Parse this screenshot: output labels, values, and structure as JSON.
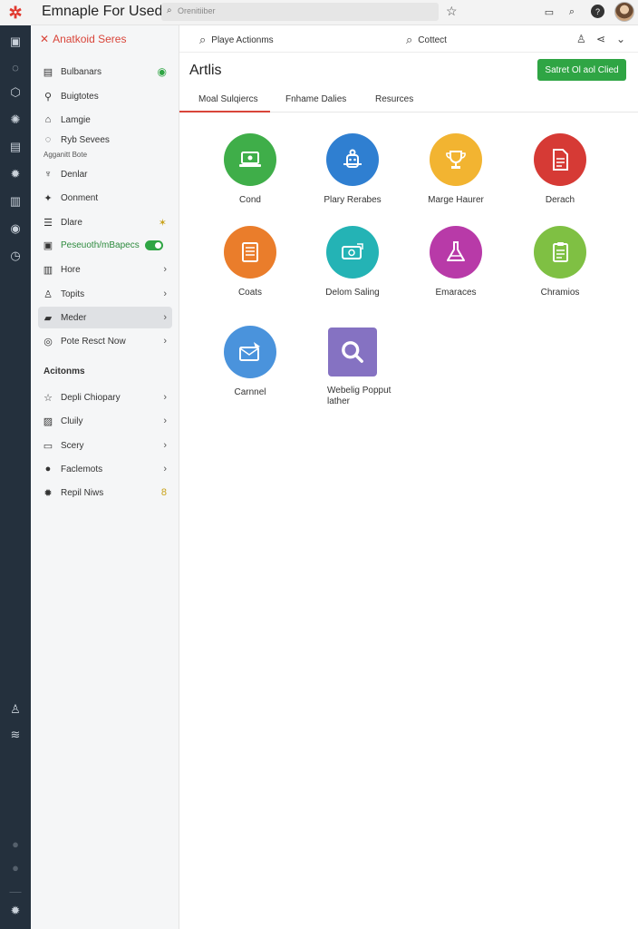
{
  "app": {
    "title": "Emnaple For Used)",
    "search_placeholder": "Orenitiiber",
    "accent_color": "#d9453a",
    "primary_color": "#2fa544"
  },
  "rail": {
    "logo_icon": "app-logo-icon",
    "icons": [
      "home-icon",
      "refresh-icon",
      "settings-icon",
      "gear-icon",
      "chat-icon",
      "cog-icon",
      "building-icon",
      "globe-icon",
      "clock-icon",
      "person-icon",
      "layers-icon",
      "settings-icon"
    ]
  },
  "sidebar": {
    "header": "Anatkoid Seres",
    "sub_caption": "Agganitt Bote",
    "items": [
      {
        "label": "Bulbanars",
        "icon": "grid-icon",
        "trail": "●"
      },
      {
        "label": "Buigtotes",
        "icon": "person-icon",
        "trail": ""
      },
      {
        "label": "Lamgie",
        "icon": "home-icon",
        "trail": ""
      },
      {
        "label": "Ryb Sevees",
        "icon": "chat-icon",
        "trail": ""
      },
      {
        "label": "Denlar",
        "icon": "lamp-icon",
        "trail": ""
      },
      {
        "label": "Oonment",
        "icon": "bird-icon",
        "trail": ""
      },
      {
        "label": "Dlare",
        "icon": "list-icon",
        "trail": "✶"
      },
      {
        "label": "Peseuoth/mBapecs",
        "icon": "table-icon",
        "trail": ""
      },
      {
        "label": "Hore",
        "icon": "box-icon",
        "trail": "›"
      },
      {
        "label": "Topits",
        "icon": "person-icon",
        "trail": "›"
      },
      {
        "label": "Meder",
        "icon": "folder-icon",
        "trail": "›"
      },
      {
        "label": "Pote Resct Now",
        "icon": "bulb-icon",
        "trail": "›"
      }
    ],
    "actions_title": "Acitonms",
    "actions": [
      {
        "label": "Depli Chiopary",
        "icon": "star-icon",
        "trail": "›"
      },
      {
        "label": "Cluily",
        "icon": "image-icon",
        "trail": "›"
      },
      {
        "label": "Scery",
        "icon": "frame-icon",
        "trail": "›"
      },
      {
        "label": "Faclemots",
        "icon": "circle-icon",
        "trail": "›"
      },
      {
        "label": "Repil Niws",
        "icon": "gear-icon",
        "trail": "8"
      }
    ]
  },
  "content": {
    "toolbar": {
      "search_a": "Playe Actionms",
      "search_b": "Cottect"
    },
    "title": "Artlis",
    "primary_button": "Satret Ol aol Clied",
    "tabs": [
      "Moal Sulqiercs",
      "Fnhame Dalies",
      "Resurces"
    ],
    "tiles": [
      {
        "label": "Cond",
        "color": "#3fae49",
        "icon": "laptop-icon"
      },
      {
        "label": "Plary Rerabes",
        "color": "#2f7fd1",
        "icon": "robot-icon"
      },
      {
        "label": "Marge Haurer",
        "color": "#f2b431",
        "icon": "trophy-icon"
      },
      {
        "label": "Derach",
        "color": "#d63a35",
        "icon": "document-icon"
      },
      {
        "label": "Coats",
        "color": "#ea7d2b",
        "icon": "notebook-icon"
      },
      {
        "label": "Delom Saling",
        "color": "#24b3b5",
        "icon": "money-icon"
      },
      {
        "label": "Emaraces",
        "color": "#b83aa8",
        "icon": "flask-icon"
      },
      {
        "label": "Chramios",
        "color": "#7fc043",
        "icon": "clipboard-icon"
      },
      {
        "label": "Carnnel",
        "color": "#4a93dc",
        "icon": "mail-icon"
      },
      {
        "label": "Webelig Popput lather",
        "color": "#8572c2",
        "icon": "search-icon"
      }
    ]
  }
}
